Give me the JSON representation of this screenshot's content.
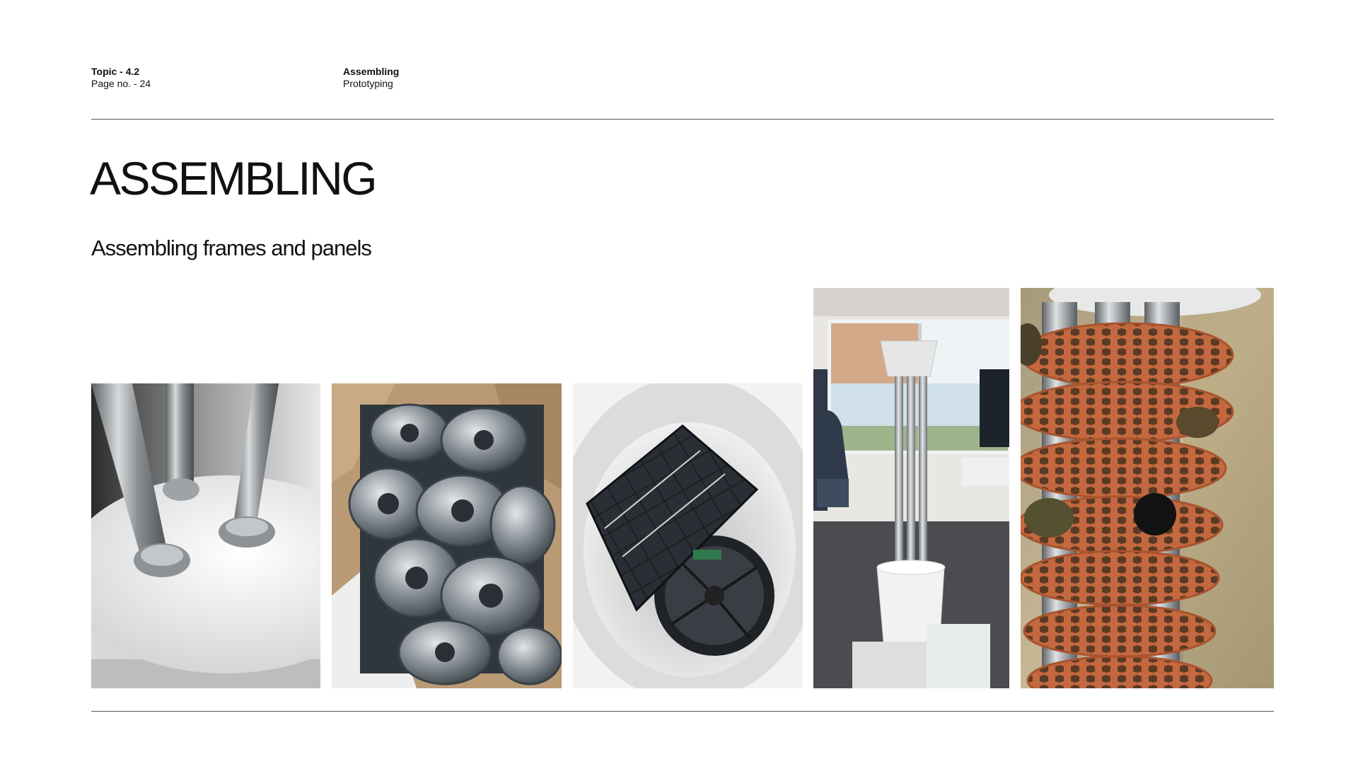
{
  "header": {
    "topic": "Topic - 4.2",
    "page_no": "Page no. - 24",
    "section": "Assembling",
    "category": "Prototyping"
  },
  "main": {
    "title": "ASSEMBLING",
    "subtitle": "Assembling frames and panels"
  },
  "photos": [
    {
      "name": "steel-poles-on-white-base-photo"
    },
    {
      "name": "metal-clamp-fittings-box-photo"
    },
    {
      "name": "solar-panel-and-fan-in-base-photo"
    },
    {
      "name": "assembled-tower-in-office-photo"
    },
    {
      "name": "terracotta-hex-rings-on-poles-photo"
    }
  ]
}
